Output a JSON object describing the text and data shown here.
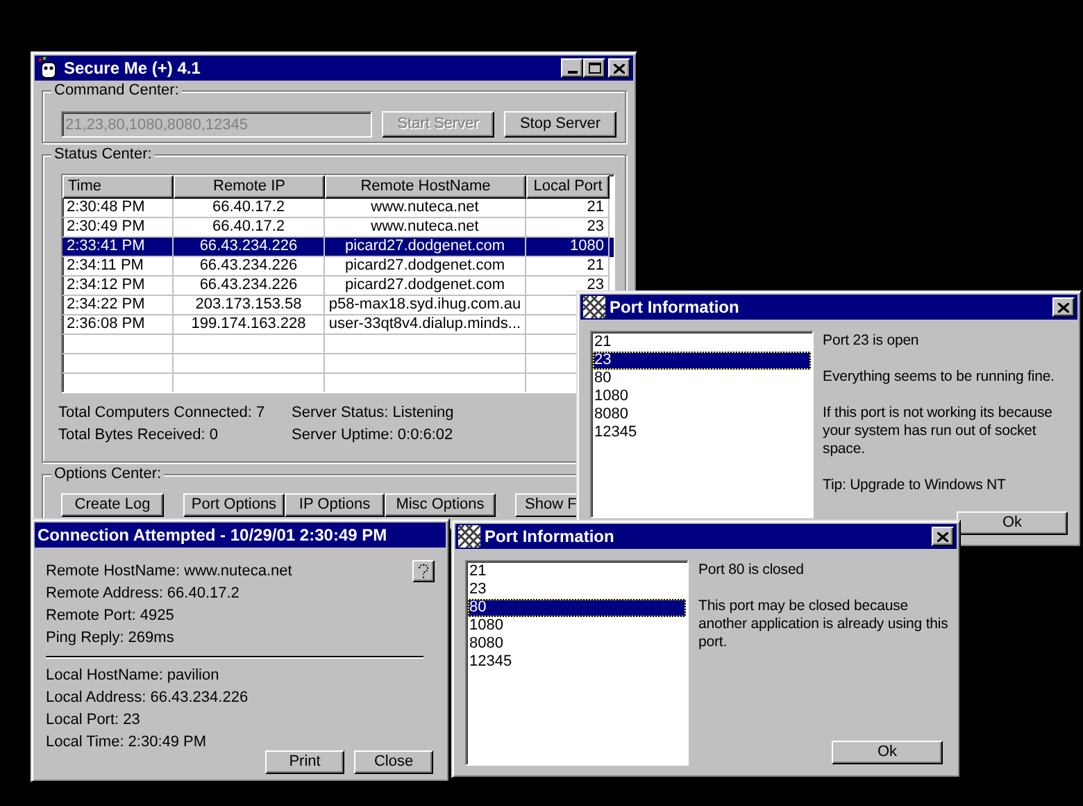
{
  "main_window": {
    "title": "Secure Me (+) 4.1",
    "command_center": {
      "label": "Command Center:",
      "ports_field": {
        "value": "21,23,80,1080,8080,12345",
        "disabled": true
      },
      "buttons": [
        {
          "label": "Start Server",
          "disabled": true
        },
        {
          "label": "Stop Server",
          "disabled": false
        }
      ]
    },
    "status_center": {
      "label": "Status Center:",
      "table": {
        "columns": [
          "Time",
          "Remote IP",
          "Remote HostName",
          "Local Port"
        ],
        "rows": [
          {
            "cells": [
              "2:30:48 PM",
              "66.40.17.2",
              "www.nuteca.net",
              "21"
            ],
            "selected": false
          },
          {
            "cells": [
              "2:30:49 PM",
              "66.40.17.2",
              "www.nuteca.net",
              "23"
            ],
            "selected": false
          },
          {
            "cells": [
              "2:33:41 PM",
              "66.43.234.226",
              "picard27.dodgenet.com",
              "1080"
            ],
            "selected": true
          },
          {
            "cells": [
              "2:34:11 PM",
              "66.43.234.226",
              "picard27.dodgenet.com",
              "21"
            ],
            "selected": false
          },
          {
            "cells": [
              "2:34:12 PM",
              "66.43.234.226",
              "picard27.dodgenet.com",
              "23"
            ],
            "selected": false
          },
          {
            "cells": [
              "2:34:22 PM",
              "203.173.153.58",
              "p58-max18.syd.ihug.com.au"
            ],
            "selected": false
          },
          {
            "cells": [
              "2:36:08 PM",
              "199.174.163.228",
              "user-33qt8v4.dialup.minds..."
            ],
            "selected": false
          }
        ]
      },
      "stats": [
        "Total Computers Connected: 7",
        "Server Status: Listening",
        "Total Bytes Received: 0",
        "Server Uptime: 0:0:6:02"
      ]
    },
    "options_center": {
      "label": "Options Center:",
      "buttons": [
        "Create Log",
        "Port Options",
        "IP Options",
        "Misc Options",
        "Show F"
      ]
    }
  },
  "port_windows": [
    {
      "title": "Port Information",
      "ports": [
        {
          "label": "21",
          "selected": false
        },
        {
          "label": "23",
          "selected": true
        },
        {
          "label": "80",
          "selected": false
        },
        {
          "label": "1080",
          "selected": false
        },
        {
          "label": "8080",
          "selected": false
        },
        {
          "label": "12345",
          "selected": false
        }
      ],
      "messages": [
        "Port 23 is open",
        "Everything seems to be running fine.",
        "If this port is not working its because your system has run out of socket space.",
        "Tip: Upgrade to Windows NT"
      ],
      "ok_button": "Ok"
    },
    {
      "title": "Port Information",
      "ports": [
        {
          "label": "21",
          "selected": false
        },
        {
          "label": "23",
          "selected": false
        },
        {
          "label": "80",
          "selected": true
        },
        {
          "label": "1080",
          "selected": false
        },
        {
          "label": "8080",
          "selected": false
        },
        {
          "label": "12345",
          "selected": false
        }
      ],
      "messages": [
        "Port 80 is closed",
        "This port may be closed because another application is already using this port."
      ],
      "ok_button": "Ok"
    }
  ],
  "connection_window": {
    "title": "Connection Attempted - 10/29/01 2:30:49 PM",
    "remote_lines": [
      "Remote HostName: www.nuteca.net",
      "Remote Address: 66.40.17.2",
      "Remote Port: 4925",
      "Ping Reply: 269ms"
    ],
    "local_lines": [
      "Local HostName: pavilion",
      "Local Address: 66.43.234.226",
      "Local Port: 23",
      "Local Time: 2:30:49 PM"
    ],
    "buttons": [
      "Print",
      "Close"
    ]
  }
}
